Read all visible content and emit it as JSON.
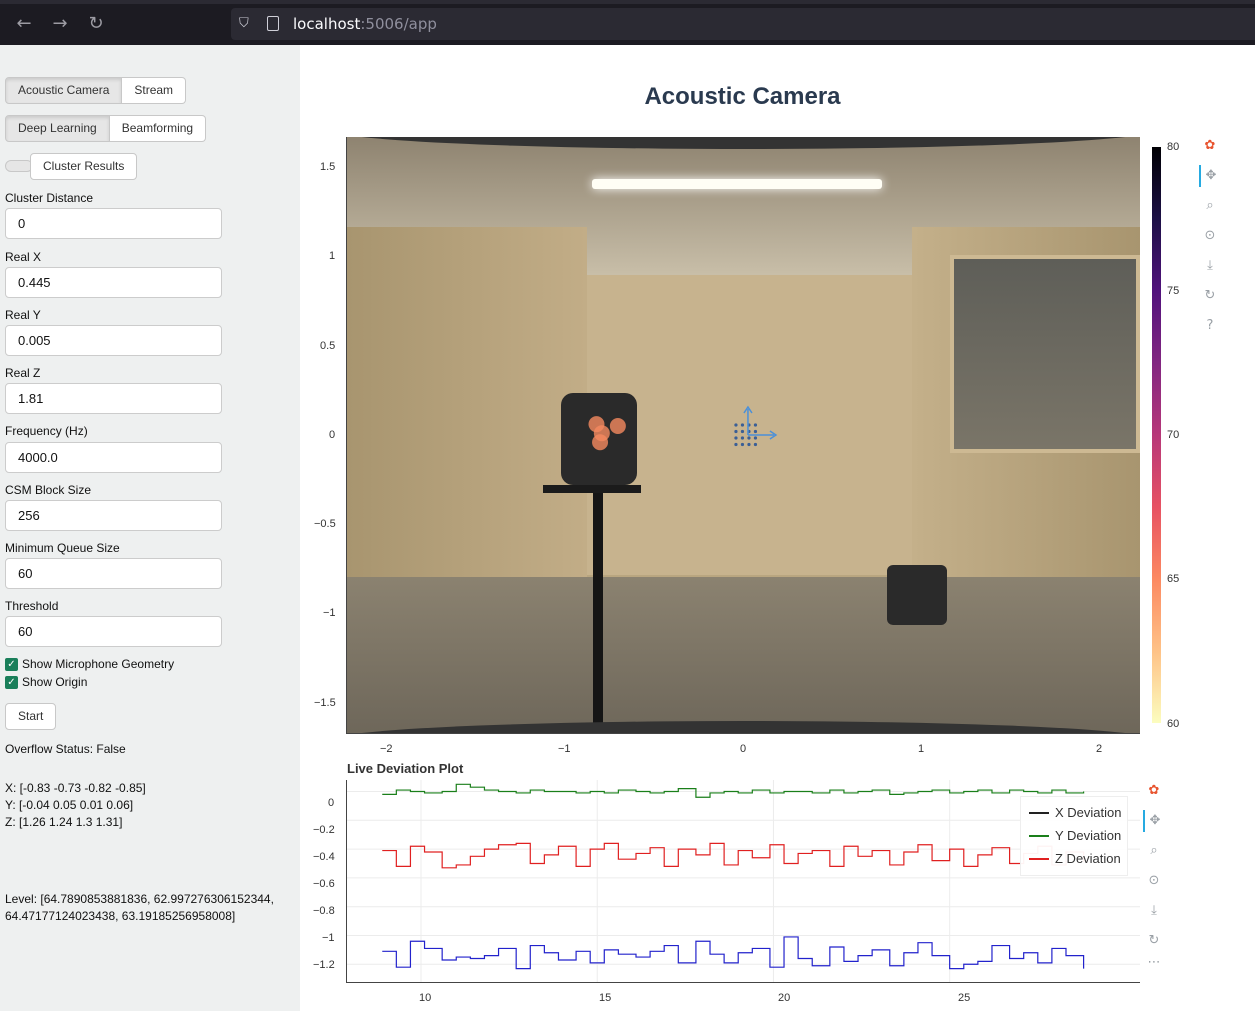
{
  "browser": {
    "url_host": "localhost",
    "url_port_path": ":5006/app"
  },
  "sidebar": {
    "mode_tabs": [
      "Acoustic Camera",
      "Stream"
    ],
    "method_tabs": [
      "Deep Learning",
      "Beamforming"
    ],
    "cluster_button": "Cluster Results",
    "fields": [
      {
        "label": "Cluster Distance",
        "value": "0"
      },
      {
        "label": "Real X",
        "value": "0.445"
      },
      {
        "label": "Real Y",
        "value": "0.005"
      },
      {
        "label": "Real Z",
        "value": "1.81"
      },
      {
        "label": "Frequency (Hz)",
        "value": "4000.0"
      },
      {
        "label": "CSM Block Size",
        "value": "256"
      },
      {
        "label": "Minimum Queue Size",
        "value": "60"
      },
      {
        "label": "Threshold",
        "value": "60"
      }
    ],
    "checkboxes": [
      {
        "label": "Show Microphone Geometry",
        "checked": true
      },
      {
        "label": "Show Origin",
        "checked": true
      }
    ],
    "start_button": "Start",
    "overflow_status": "Overflow Status: False",
    "xyz_lines": [
      "X: [-0.83 -0.73 -0.82 -0.85]",
      "Y: [-0.04 0.05 0.01 0.06]",
      "Z: [1.26 1.24 1.3 1.31]"
    ],
    "level_lines": [
      "Level: [64.7890853881836, 62.997276306152344,",
      "64.47177124023438, 63.19185256958008]"
    ]
  },
  "main": {
    "title": "Acoustic Camera",
    "camera_plot": {
      "x_ticks": [
        "−2",
        "−1",
        "0",
        "1",
        "2"
      ],
      "y_ticks": [
        "1.5",
        "1",
        "0.5",
        "0",
        "−0.5",
        "−1",
        "−1.5"
      ],
      "colorbar_ticks": [
        "80",
        "75",
        "70",
        "65",
        "60"
      ]
    },
    "deviation_plot": {
      "title": "Live Deviation Plot",
      "x_ticks": [
        "10",
        "15",
        "20",
        "25"
      ],
      "y_ticks": [
        "0",
        "−0.2",
        "−0.4",
        "−0.6",
        "−0.8",
        "−1",
        "−1.2"
      ],
      "legend": [
        {
          "label": "X Deviation",
          "color": "#222222"
        },
        {
          "label": "Y Deviation",
          "color": "#1a7f1a"
        },
        {
          "label": "Z Deviation",
          "color": "#e02020"
        }
      ]
    }
  },
  "icons": {
    "toolbar": [
      "bokeh-logo-icon",
      "pan-icon",
      "box-zoom-icon",
      "wheel-zoom-icon",
      "save-icon",
      "reset-icon",
      "help-icon"
    ]
  },
  "chart_data": [
    {
      "type": "scatter",
      "xlim": [
        -2.25,
        2.2
      ],
      "ylim": [
        -1.65,
        1.65
      ],
      "colorbar_range": [
        60,
        80
      ],
      "sources": {
        "x": [
          -0.83,
          -0.73,
          -0.82,
          -0.85
        ],
        "y": [
          -0.04,
          0.05,
          0.01,
          0.06
        ]
      },
      "microphone_grid": {
        "center": [
          0,
          0
        ]
      }
    },
    {
      "type": "line",
      "title": "Live Deviation Plot",
      "xlim": [
        7.9,
        30.4
      ],
      "ylim": [
        -1.33,
        0.08
      ],
      "x": [
        8.9,
        9.3,
        9.7,
        10.1,
        10.6,
        11.0,
        11.4,
        11.8,
        12.2,
        12.7,
        13.1,
        13.5,
        13.9,
        14.4,
        14.8,
        15.2,
        15.6,
        16.1,
        16.5,
        16.9,
        17.3,
        17.8,
        18.2,
        18.6,
        19.0,
        19.4,
        19.9,
        20.3,
        20.7,
        21.1,
        21.6,
        22.0,
        22.4,
        22.8,
        23.3,
        23.7,
        24.1,
        24.5,
        25.0,
        25.4,
        25.8,
        26.2,
        26.7,
        27.1,
        27.5,
        27.9,
        28.3,
        28.8
      ],
      "series": [
        {
          "name": "X Deviation",
          "values": [
            -1.11,
            -1.22,
            -1.04,
            -1.09,
            -1.17,
            -1.15,
            -1.16,
            -1.14,
            -1.09,
            -1.23,
            -1.07,
            -1.12,
            -1.17,
            -1.11,
            -1.19,
            -1.1,
            -1.13,
            -1.15,
            -1.11,
            -1.07,
            -1.19,
            -1.04,
            -1.13,
            -1.19,
            -1.12,
            -1.09,
            -1.22,
            -1.01,
            -1.16,
            -1.21,
            -1.08,
            -1.18,
            -1.14,
            -1.1,
            -1.21,
            -1.12,
            -1.05,
            -1.14,
            -1.23,
            -1.2,
            -1.18,
            -1.07,
            -1.16,
            -1.12,
            -1.19,
            -1.09,
            -1.14,
            -1.23
          ]
        },
        {
          "name": "Y Deviation",
          "values": [
            -0.02,
            0.01,
            0.0,
            -0.01,
            0.0,
            0.05,
            0.03,
            0.01,
            0.0,
            -0.01,
            0.01,
            0.0,
            0.0,
            -0.01,
            0.0,
            -0.01,
            0.01,
            0.0,
            -0.01,
            0.0,
            0.02,
            -0.04,
            -0.01,
            0.0,
            -0.01,
            0.01,
            -0.01,
            0.0,
            0.0,
            -0.01,
            0.01,
            -0.01,
            0.0,
            0.01,
            -0.02,
            -0.01,
            0.0,
            0.01,
            -0.01,
            0.0,
            0.01,
            -0.01,
            0.01,
            0.0,
            -0.01,
            0.01,
            -0.01,
            0.0
          ]
        },
        {
          "name": "Z Deviation",
          "values": [
            -0.41,
            -0.52,
            -0.38,
            -0.42,
            -0.53,
            -0.51,
            -0.45,
            -0.4,
            -0.37,
            -0.36,
            -0.5,
            -0.44,
            -0.38,
            -0.52,
            -0.4,
            -0.36,
            -0.47,
            -0.43,
            -0.39,
            -0.52,
            -0.4,
            -0.44,
            -0.36,
            -0.51,
            -0.41,
            -0.46,
            -0.37,
            -0.5,
            -0.43,
            -0.41,
            -0.52,
            -0.38,
            -0.45,
            -0.41,
            -0.51,
            -0.42,
            -0.37,
            -0.48,
            -0.4,
            -0.52,
            -0.44,
            -0.39,
            -0.5,
            -0.43,
            -0.38,
            -0.51,
            -0.42,
            -0.49
          ]
        }
      ]
    }
  ]
}
